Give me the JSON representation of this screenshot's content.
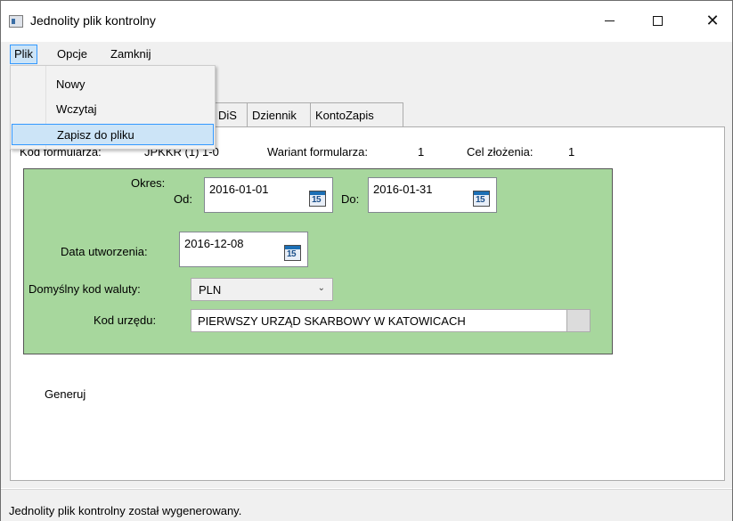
{
  "window": {
    "title": "Jednolity plik kontrolny"
  },
  "menu": {
    "items": [
      {
        "label": "Plik"
      },
      {
        "label": "Opcje"
      },
      {
        "label": "Zamknij"
      }
    ],
    "dropdown": [
      {
        "label": "Nowy"
      },
      {
        "label": "Wczytaj"
      },
      {
        "label": "Zapisz do pliku"
      }
    ]
  },
  "tabs": [
    {
      "label": "DiS"
    },
    {
      "label": "Dziennik"
    },
    {
      "label": "KontoZapis"
    }
  ],
  "header_info": {
    "kod_label": "Kod formularza:",
    "kod_value": "JPKKR (1) 1-0",
    "wariant_label": "Wariant formularza:",
    "wariant_value": "1",
    "cel_label": "Cel złożenia:",
    "cel_value": "1"
  },
  "form": {
    "okres_label": "Okres:",
    "od_label": "Od:",
    "od_value": "2016-01-01",
    "do_label": "Do:",
    "do_value": "2016-01-31",
    "data_label": "Data utworzenia:",
    "data_value": "2016-12-08",
    "calendar_day": "15",
    "waluta_label": "Domyślny kod waluty:",
    "waluta_value": "PLN",
    "urzad_label": "Kod urzędu:",
    "urzad_value": "PIERWSZY URZĄD SKARBOWY W KATOWICACH"
  },
  "generuj_label": "Generuj",
  "status": {
    "text": "Jednolity plik kontrolny został wygenerowany."
  },
  "colors": {
    "form_bg": "#a7d79d",
    "highlight": "#cce4f7",
    "highlight_border": "#3399ff"
  }
}
